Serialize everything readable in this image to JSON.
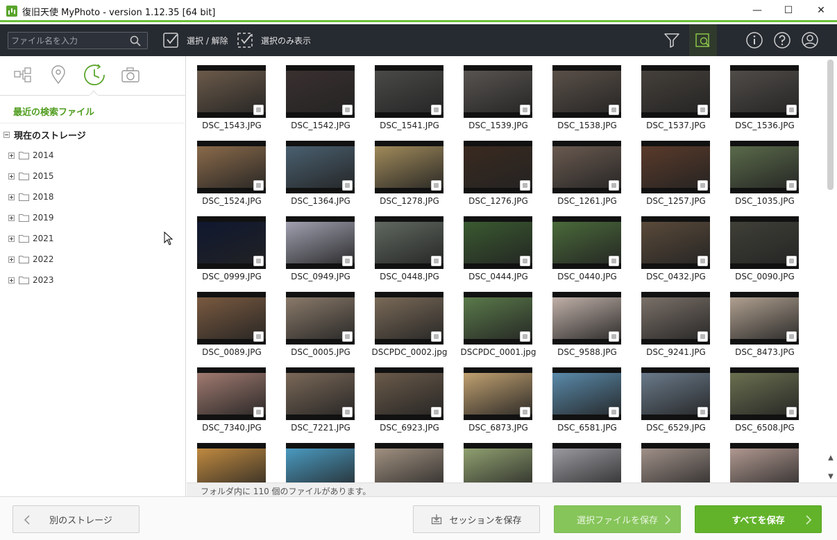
{
  "window": {
    "title": "復旧天使 MyPhoto - version 1.12.35 [64 bit]",
    "minimize_glyph": "—",
    "maximize_glyph": "☐",
    "close_glyph": "✕"
  },
  "toolbar": {
    "search_placeholder": "ファイル名を入力",
    "select_toggle_label": "選択 / 解除",
    "show_selected_label": "選択のみ表示",
    "right_icons": [
      "filter-icon",
      "preview-search-icon",
      "info-icon",
      "help-icon",
      "user-icon"
    ]
  },
  "sidebar": {
    "tabs": [
      "tree-view-icon",
      "location-pin-icon",
      "clock-icon",
      "camera-icon"
    ],
    "active_tab": "clock-icon",
    "recent_label": "最近の検索ファイル",
    "storage_label": "現在のストレージ",
    "folders": [
      "2014",
      "2015",
      "2018",
      "2019",
      "2021",
      "2022",
      "2023"
    ]
  },
  "grid": {
    "rows": [
      [
        "DSC_1543.JPG",
        "DSC_1542.JPG",
        "DSC_1541.JPG",
        "DSC_1539.JPG",
        "DSC_1538.JPG",
        "DSC_1537.JPG",
        "DSC_1536.JPG"
      ],
      [
        "DSC_1524.JPG",
        "DSC_1364.JPG",
        "DSC_1278.JPG",
        "DSC_1276.JPG",
        "DSC_1261.JPG",
        "DSC_1257.JPG",
        "DSC_1035.JPG"
      ],
      [
        "DSC_0999.JPG",
        "DSC_0949.JPG",
        "DSC_0448.JPG",
        "DSC_0444.JPG",
        "DSC_0440.JPG",
        "DSC_0432.JPG",
        "DSC_0090.JPG"
      ],
      [
        "DSC_0089.JPG",
        "DSC_0005.JPG",
        "DSCPDC_0002.jpg",
        "DSCPDC_0001.jpg",
        "DSC_9588.JPG",
        "DSC_9241.JPG",
        "DSC_8473.JPG"
      ],
      [
        "DSC_7340.JPG",
        "DSC_7221.JPG",
        "DSC_6923.JPG",
        "DSC_6873.JPG",
        "DSC_6581.JPG",
        "DSC_6529.JPG",
        "DSC_6508.JPG"
      ],
      [
        "",
        "",
        "",
        "",
        "",
        "",
        ""
      ]
    ],
    "thumb_colors": [
      [
        "#6b5a4a",
        "#3a3030",
        "#4a4a48",
        "#585450",
        "#5a5048",
        "#45403a",
        "#504c48"
      ],
      [
        "#8a6a4a",
        "#4a6070",
        "#a08a5a",
        "#3a2a20",
        "#6a5a50",
        "#5a3a2a",
        "#5a6a4a"
      ],
      [
        "#101830",
        "#a0a0b0",
        "#606860",
        "#3a5a30",
        "#4a6a3a",
        "#5a4a3a",
        "#404038"
      ],
      [
        "#7a5a40",
        "#8a7a6a",
        "#7a6a58",
        "#5a7a4a",
        "#c0b0a8",
        "#7a7068",
        "#b0a090"
      ],
      [
        "#a07a70",
        "#7a6858",
        "#6a5a4a",
        "#c0a070",
        "#5a8aaa",
        "#6a7a8a",
        "#6a7050"
      ],
      [
        "#c08a40",
        "#4a9ac0",
        "#a09080",
        "#90a070",
        "#9a9aa0",
        "#a09088",
        "#b09890"
      ]
    ]
  },
  "status": {
    "text": "フォルダ内に 110 個のファイルがあります。"
  },
  "bottom": {
    "back_label": "別のストレージ",
    "session_label": "セッションを保存",
    "save_selected_label": "選択ファイルを保存",
    "save_all_label": "すべてを保存"
  },
  "colors": {
    "accent": "#62b32a",
    "toolbar_bg": "#262a31",
    "recent_text": "#4f9d1f"
  }
}
